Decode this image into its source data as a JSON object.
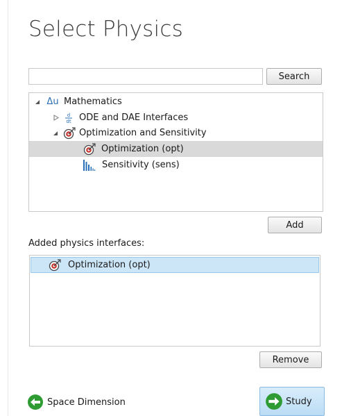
{
  "page": {
    "title": "Select Physics"
  },
  "search": {
    "value": "",
    "placeholder": "",
    "button_label": "Search"
  },
  "tree": {
    "items": [
      {
        "label": "Mathematics",
        "icon": "delta-u-icon",
        "expanded": true,
        "level": 0
      },
      {
        "label": "ODE and DAE Interfaces",
        "icon": "d-dt-icon",
        "expanded": false,
        "level": 1
      },
      {
        "label": "Optimization and Sensitivity",
        "icon": "optimization-target-icon",
        "expanded": true,
        "level": 1
      },
      {
        "label": "Optimization (opt)",
        "icon": "optimization-target-icon",
        "selected": true,
        "level": 2
      },
      {
        "label": "Sensitivity (sens)",
        "icon": "sensitivity-bars-icon",
        "level": 2
      }
    ]
  },
  "add_button_label": "Add",
  "added": {
    "label": "Added physics interfaces:",
    "items": [
      {
        "label": "Optimization (opt)",
        "icon": "optimization-target-icon"
      }
    ]
  },
  "remove_button_label": "Remove",
  "nav": {
    "back_label": "Space Dimension",
    "next_label": "Study"
  },
  "colors": {
    "selection_grey": "#d9d9d9",
    "selection_blue": "#cde6f7",
    "nav_green": "#2f9b33",
    "icon_blue": "#2a6fb8",
    "target_red": "#c8302a"
  }
}
